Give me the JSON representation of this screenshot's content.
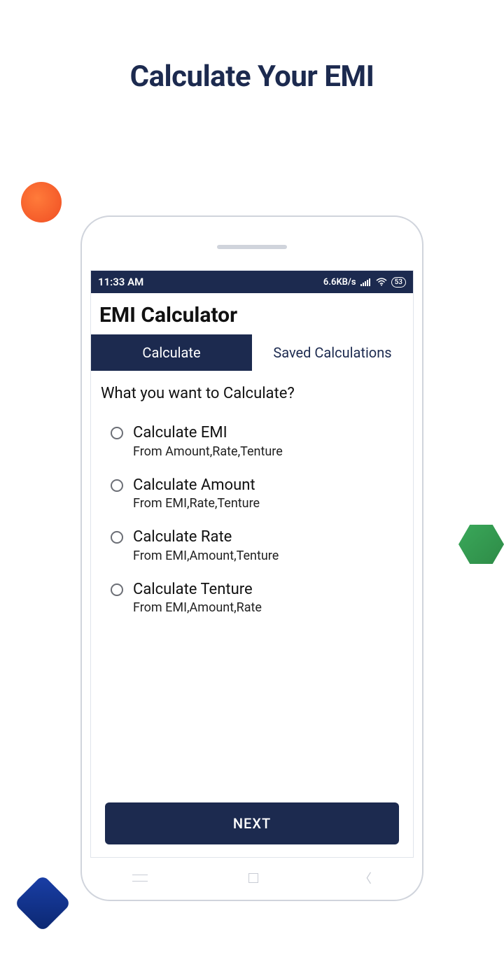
{
  "page": {
    "title": "Calculate Your EMI"
  },
  "statusBar": {
    "time": "11:33 AM",
    "netSpeed": "6.6KB/s",
    "battery": "53"
  },
  "app": {
    "title": "EMI Calculator",
    "tabs": [
      {
        "label": "Calculate"
      },
      {
        "label": "Saved Calculations"
      }
    ],
    "question": "What you want to Calculate?",
    "options": [
      {
        "title": "Calculate EMI",
        "subtitle": "From Amount,Rate,Tenture"
      },
      {
        "title": "Calculate Amount",
        "subtitle": "From EMI,Rate,Tenture"
      },
      {
        "title": "Calculate Rate",
        "subtitle": "From EMI,Amount,Tenture"
      },
      {
        "title": "Calculate Tenture",
        "subtitle": "From EMI,Amount,Rate"
      }
    ],
    "nextLabel": "NEXT"
  }
}
